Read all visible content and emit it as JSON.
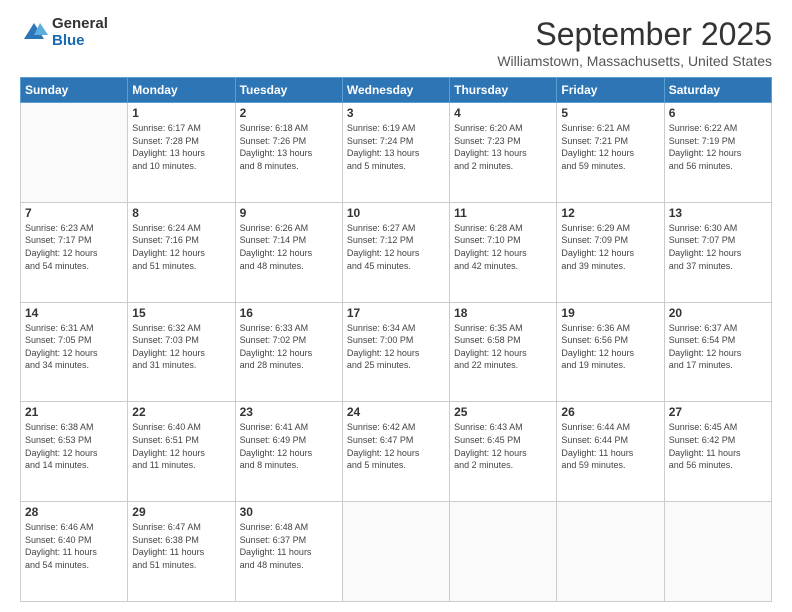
{
  "logo": {
    "general": "General",
    "blue": "Blue"
  },
  "header": {
    "month": "September 2025",
    "location": "Williamstown, Massachusetts, United States"
  },
  "days_of_week": [
    "Sunday",
    "Monday",
    "Tuesday",
    "Wednesday",
    "Thursday",
    "Friday",
    "Saturday"
  ],
  "weeks": [
    [
      {
        "day": "",
        "info": ""
      },
      {
        "day": "1",
        "info": "Sunrise: 6:17 AM\nSunset: 7:28 PM\nDaylight: 13 hours\nand 10 minutes."
      },
      {
        "day": "2",
        "info": "Sunrise: 6:18 AM\nSunset: 7:26 PM\nDaylight: 13 hours\nand 8 minutes."
      },
      {
        "day": "3",
        "info": "Sunrise: 6:19 AM\nSunset: 7:24 PM\nDaylight: 13 hours\nand 5 minutes."
      },
      {
        "day": "4",
        "info": "Sunrise: 6:20 AM\nSunset: 7:23 PM\nDaylight: 13 hours\nand 2 minutes."
      },
      {
        "day": "5",
        "info": "Sunrise: 6:21 AM\nSunset: 7:21 PM\nDaylight: 12 hours\nand 59 minutes."
      },
      {
        "day": "6",
        "info": "Sunrise: 6:22 AM\nSunset: 7:19 PM\nDaylight: 12 hours\nand 56 minutes."
      }
    ],
    [
      {
        "day": "7",
        "info": "Sunrise: 6:23 AM\nSunset: 7:17 PM\nDaylight: 12 hours\nand 54 minutes."
      },
      {
        "day": "8",
        "info": "Sunrise: 6:24 AM\nSunset: 7:16 PM\nDaylight: 12 hours\nand 51 minutes."
      },
      {
        "day": "9",
        "info": "Sunrise: 6:26 AM\nSunset: 7:14 PM\nDaylight: 12 hours\nand 48 minutes."
      },
      {
        "day": "10",
        "info": "Sunrise: 6:27 AM\nSunset: 7:12 PM\nDaylight: 12 hours\nand 45 minutes."
      },
      {
        "day": "11",
        "info": "Sunrise: 6:28 AM\nSunset: 7:10 PM\nDaylight: 12 hours\nand 42 minutes."
      },
      {
        "day": "12",
        "info": "Sunrise: 6:29 AM\nSunset: 7:09 PM\nDaylight: 12 hours\nand 39 minutes."
      },
      {
        "day": "13",
        "info": "Sunrise: 6:30 AM\nSunset: 7:07 PM\nDaylight: 12 hours\nand 37 minutes."
      }
    ],
    [
      {
        "day": "14",
        "info": "Sunrise: 6:31 AM\nSunset: 7:05 PM\nDaylight: 12 hours\nand 34 minutes."
      },
      {
        "day": "15",
        "info": "Sunrise: 6:32 AM\nSunset: 7:03 PM\nDaylight: 12 hours\nand 31 minutes."
      },
      {
        "day": "16",
        "info": "Sunrise: 6:33 AM\nSunset: 7:02 PM\nDaylight: 12 hours\nand 28 minutes."
      },
      {
        "day": "17",
        "info": "Sunrise: 6:34 AM\nSunset: 7:00 PM\nDaylight: 12 hours\nand 25 minutes."
      },
      {
        "day": "18",
        "info": "Sunrise: 6:35 AM\nSunset: 6:58 PM\nDaylight: 12 hours\nand 22 minutes."
      },
      {
        "day": "19",
        "info": "Sunrise: 6:36 AM\nSunset: 6:56 PM\nDaylight: 12 hours\nand 19 minutes."
      },
      {
        "day": "20",
        "info": "Sunrise: 6:37 AM\nSunset: 6:54 PM\nDaylight: 12 hours\nand 17 minutes."
      }
    ],
    [
      {
        "day": "21",
        "info": "Sunrise: 6:38 AM\nSunset: 6:53 PM\nDaylight: 12 hours\nand 14 minutes."
      },
      {
        "day": "22",
        "info": "Sunrise: 6:40 AM\nSunset: 6:51 PM\nDaylight: 12 hours\nand 11 minutes."
      },
      {
        "day": "23",
        "info": "Sunrise: 6:41 AM\nSunset: 6:49 PM\nDaylight: 12 hours\nand 8 minutes."
      },
      {
        "day": "24",
        "info": "Sunrise: 6:42 AM\nSunset: 6:47 PM\nDaylight: 12 hours\nand 5 minutes."
      },
      {
        "day": "25",
        "info": "Sunrise: 6:43 AM\nSunset: 6:45 PM\nDaylight: 12 hours\nand 2 minutes."
      },
      {
        "day": "26",
        "info": "Sunrise: 6:44 AM\nSunset: 6:44 PM\nDaylight: 11 hours\nand 59 minutes."
      },
      {
        "day": "27",
        "info": "Sunrise: 6:45 AM\nSunset: 6:42 PM\nDaylight: 11 hours\nand 56 minutes."
      }
    ],
    [
      {
        "day": "28",
        "info": "Sunrise: 6:46 AM\nSunset: 6:40 PM\nDaylight: 11 hours\nand 54 minutes."
      },
      {
        "day": "29",
        "info": "Sunrise: 6:47 AM\nSunset: 6:38 PM\nDaylight: 11 hours\nand 51 minutes."
      },
      {
        "day": "30",
        "info": "Sunrise: 6:48 AM\nSunset: 6:37 PM\nDaylight: 11 hours\nand 48 minutes."
      },
      {
        "day": "",
        "info": ""
      },
      {
        "day": "",
        "info": ""
      },
      {
        "day": "",
        "info": ""
      },
      {
        "day": "",
        "info": ""
      }
    ]
  ]
}
